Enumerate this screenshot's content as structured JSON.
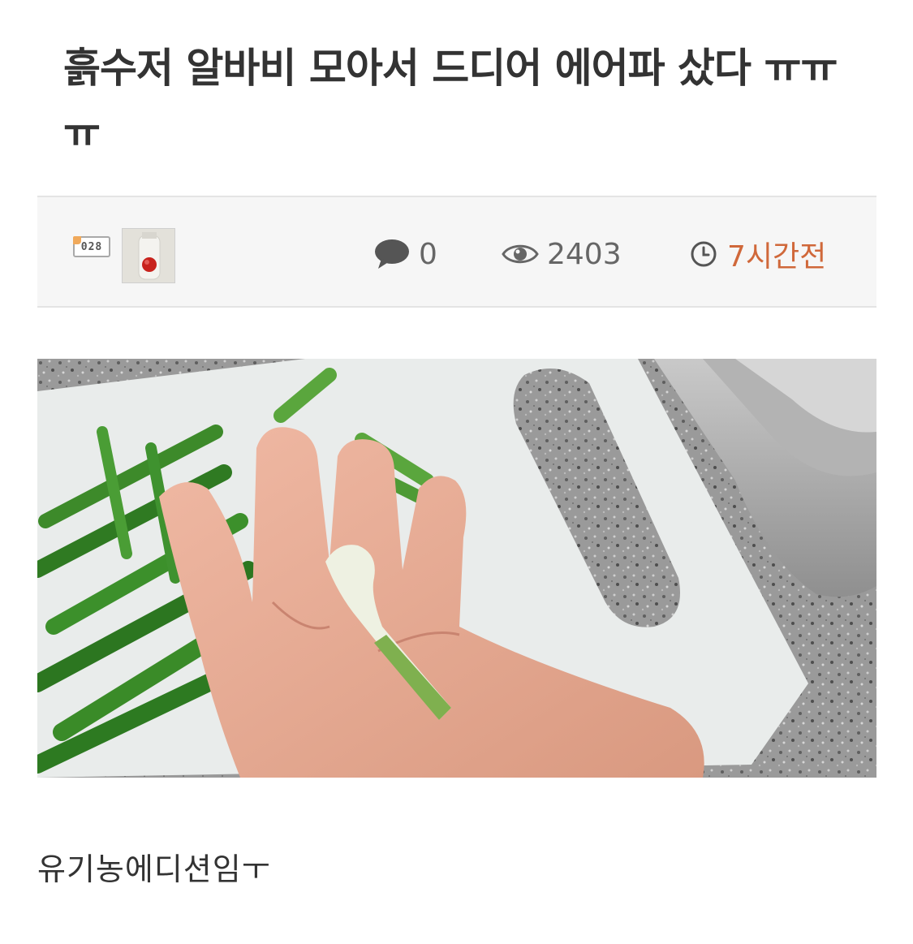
{
  "post": {
    "title": "흙수저 알바비 모아서 드디어 에어파 샀다 ㅠㅠㅠ",
    "body": "유기농에디션임ㅜ"
  },
  "meta": {
    "level_badge": "028",
    "comments_count": "0",
    "views_count": "2403",
    "time_ago": "7시간전",
    "accent_color": "#d0683a"
  },
  "icons": {
    "comments": "speech-bubble-icon",
    "views": "eye-icon",
    "time": "clock-icon"
  }
}
